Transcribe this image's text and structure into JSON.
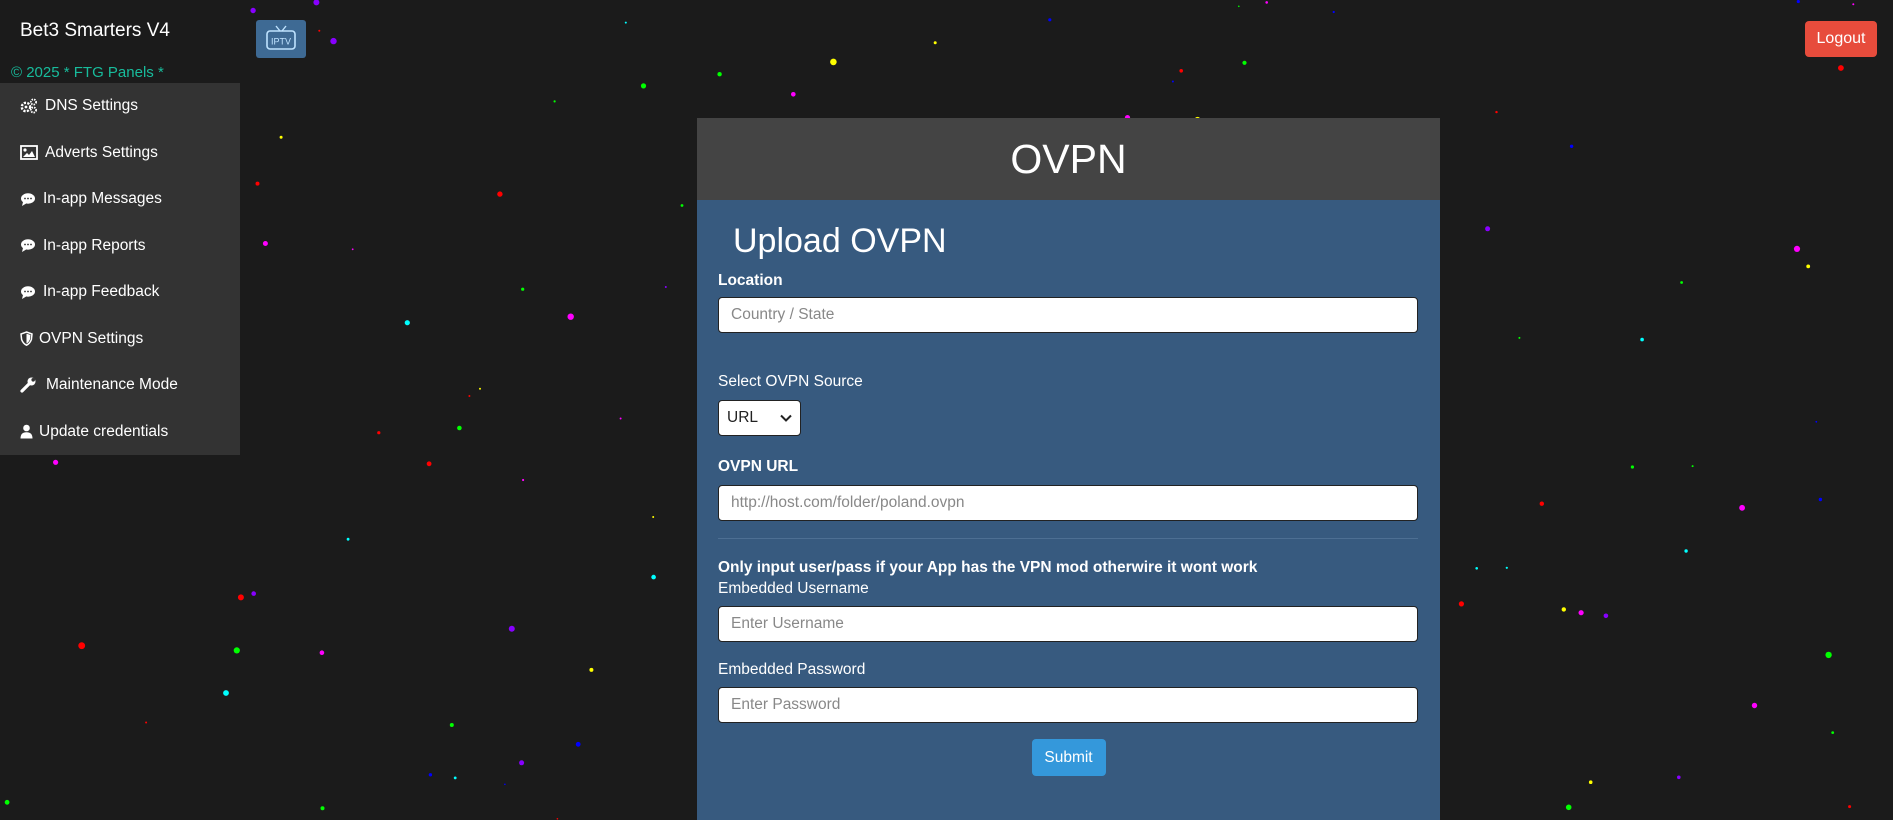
{
  "header": {
    "brand": "Bet3 Smarters V4",
    "copyright": "© 2025 * FTG Panels *",
    "logo_text": "IPTV",
    "logout_label": "Logout"
  },
  "sidebar": {
    "items": [
      {
        "label": "DNS Settings",
        "icon": "cogs-icon"
      },
      {
        "label": "Adverts Settings",
        "icon": "image-icon"
      },
      {
        "label": "In-app Messages",
        "icon": "comment-icon"
      },
      {
        "label": "In-app Reports",
        "icon": "comment-icon"
      },
      {
        "label": "In-app Feedback",
        "icon": "comment-icon"
      },
      {
        "label": "OVPN Settings",
        "icon": "shield-icon"
      },
      {
        "label": "Maintenance Mode",
        "icon": "wrench-icon"
      },
      {
        "label": "Update credentials",
        "icon": "user-icon"
      }
    ]
  },
  "panel": {
    "title": "OVPN",
    "subtitle": "Upload OVPN",
    "location_label": "Location",
    "location_placeholder": "Country / State",
    "source_label": "Select OVPN Source",
    "source_selected": "URL",
    "url_label": "OVPN URL",
    "url_placeholder": "http://host.com/folder/poland.ovpn",
    "note": "Only input user/pass if your App has the VPN mod otherwire it wont work",
    "username_label": "Embedded Username",
    "username_placeholder": "Enter Username",
    "password_label": "Embedded Password",
    "password_placeholder": "Enter Password",
    "submit_label": "Submit"
  },
  "colors": {
    "background": "#1b1b1b",
    "sidebar": "#333333",
    "panel": "#375a7f",
    "panel_header": "#444444",
    "copyright": "#18bc9c",
    "logout": "#e74c3c",
    "submit": "#3498db",
    "star_colors": [
      "#ff0000",
      "#00ff00",
      "#0000ff",
      "#ffff00",
      "#ff00ff",
      "#00ffff",
      "#8800ff"
    ]
  }
}
